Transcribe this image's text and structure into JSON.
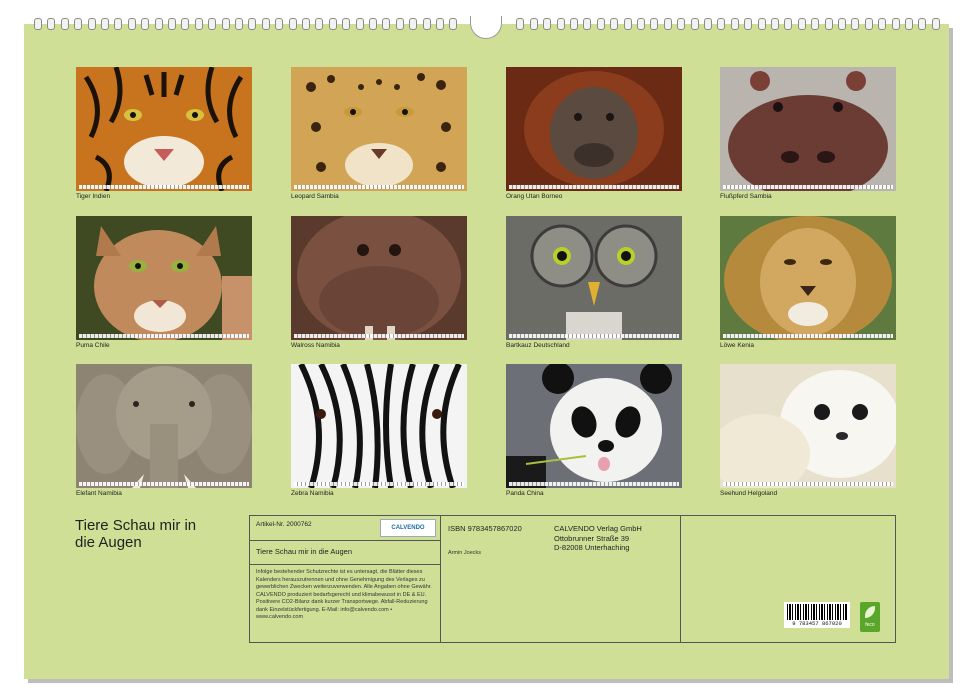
{
  "gallery": [
    {
      "caption": "Tiger Indien"
    },
    {
      "caption": "Leopard Sambia"
    },
    {
      "caption": "Orang Utan Borneo"
    },
    {
      "caption": "Flußpferd Sambia"
    },
    {
      "caption": "Puma Chile"
    },
    {
      "caption": "Walross Namibia"
    },
    {
      "caption": "Bartkauz Deutschland"
    },
    {
      "caption": "Löwe Kenia"
    },
    {
      "caption": "Elefant Namibia"
    },
    {
      "caption": "Zebra Namibia"
    },
    {
      "caption": "Panda China"
    },
    {
      "caption": "Seehund Helgoland"
    }
  ],
  "title": {
    "line1": "Tiere Schau mir in",
    "line2": "die Augen"
  },
  "info": {
    "article": "Artikel-Nr. 2000762",
    "logo": "CALVENDO",
    "product_title": "Tiere Schau mir in die Augen",
    "legal": "Infolge bestehender Schutzrechte ist es untersagt, die Blätter dieses Kalenders herauszutrennen und ohne Genehmigung des Verlages zu gewerblichen Zwecken weiterzuverwenden. Alle Angaben ohne Gewähr. CALVENDO produziert bedarfsgerecht und klimabewusst in DE & EU. Positivere CO2-Bilanz dank kurzer Transportwege. Abfall-Reduzierung dank Einzelstückfertigung. E-Mail: info@calvendo.com • www.calvendo.com",
    "isbn": "ISBN 9783457867020",
    "author": "Armin Joecks",
    "publisher": [
      "CALVENDO Verlag GmbH",
      "Ottobrunner Straße 39",
      "D-82008 Unterhaching"
    ],
    "barcode_text": "9 783457 867020",
    "eco_label": "feco"
  }
}
